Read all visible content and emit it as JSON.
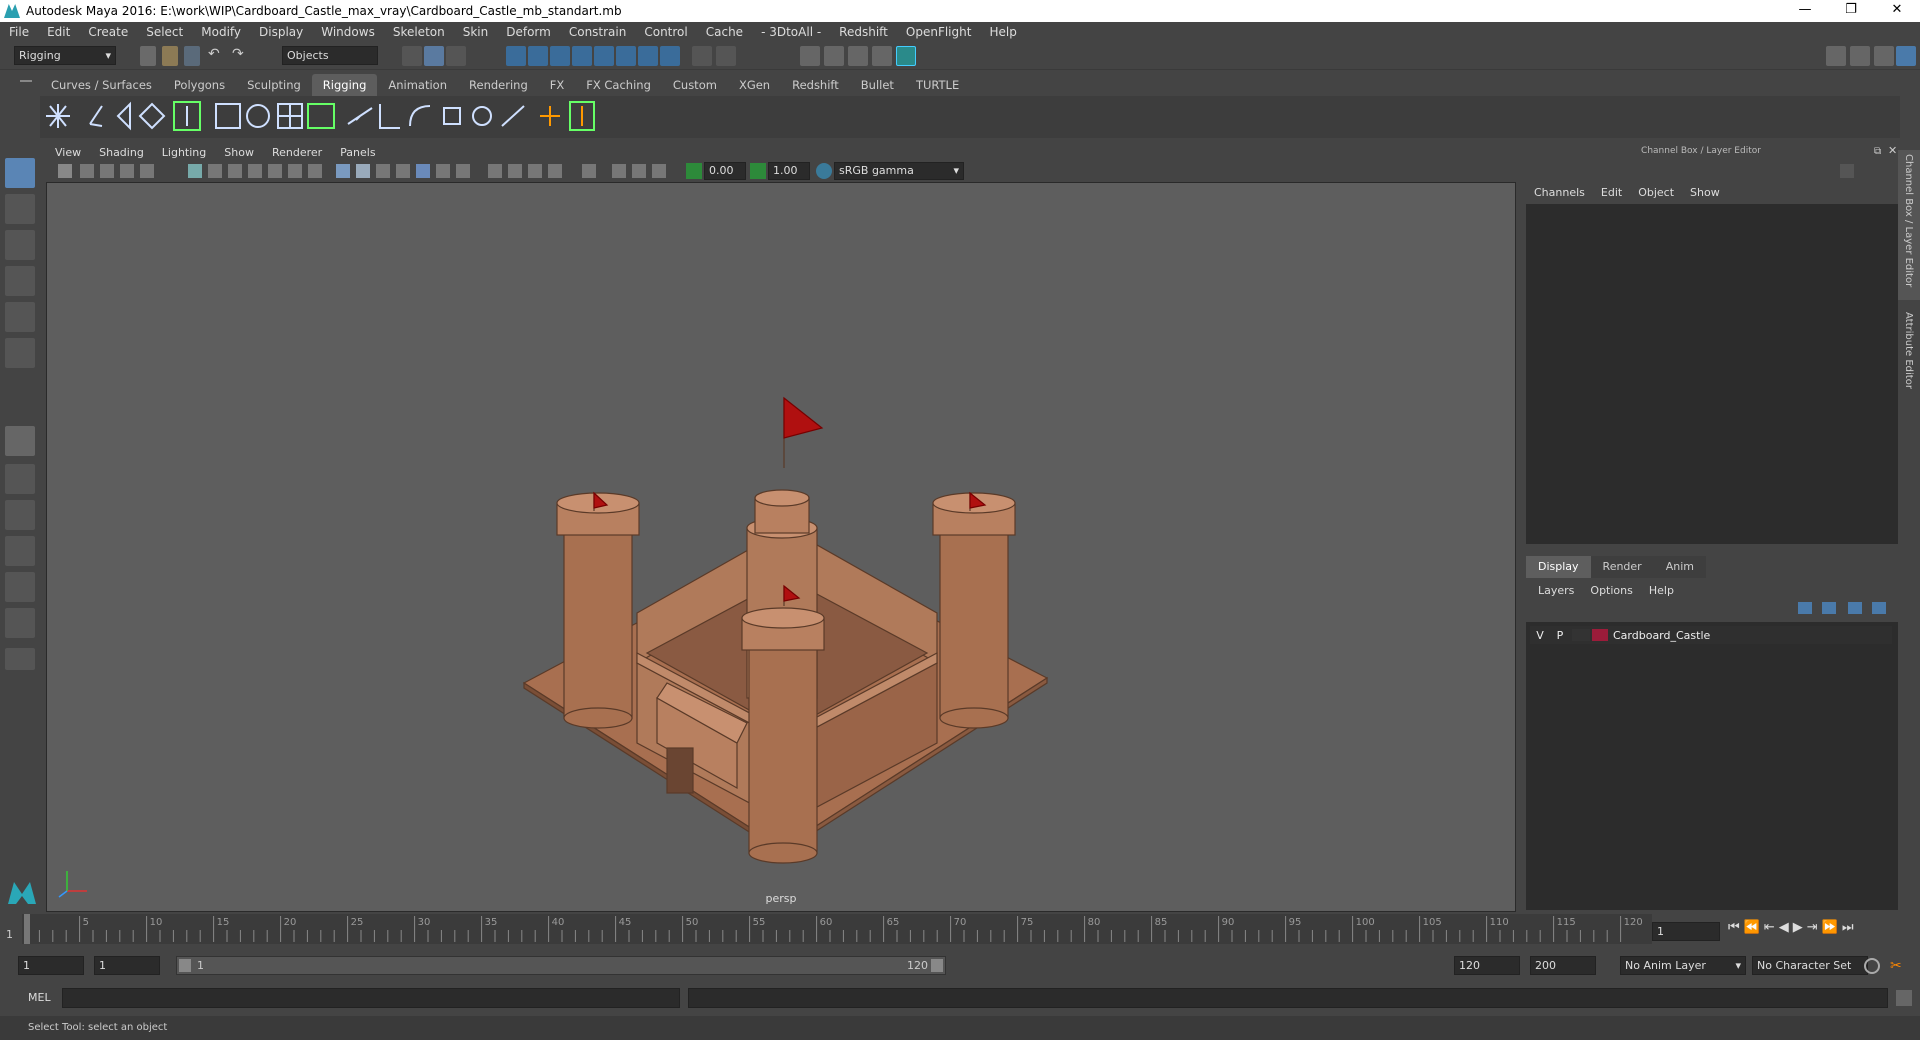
{
  "window": {
    "title": "Autodesk Maya 2016: E:\\work\\WIP\\Cardboard_Castle_max_vray\\Cardboard_Castle_mb_standart.mb",
    "controls": [
      "—",
      "❐",
      "✕"
    ]
  },
  "menubar": [
    "File",
    "Edit",
    "Create",
    "Select",
    "Modify",
    "Display",
    "Windows",
    "Skeleton",
    "Skin",
    "Deform",
    "Constrain",
    "Control",
    "Cache",
    "- 3DtoAll -",
    "Redshift",
    "OpenFlight",
    "Help"
  ],
  "statusline": {
    "menuset": "Rigging",
    "selection_mask": "Objects"
  },
  "shelf": {
    "tabs": [
      "Curves / Surfaces",
      "Polygons",
      "Sculpting",
      "Rigging",
      "Animation",
      "Rendering",
      "FX",
      "FX Caching",
      "Custom",
      "XGen",
      "Redshift",
      "Bullet",
      "TURTLE"
    ],
    "active_tab": "Rigging"
  },
  "viewport": {
    "menu": [
      "View",
      "Shading",
      "Lighting",
      "Show",
      "Renderer",
      "Panels"
    ],
    "exposure": "0.00",
    "gamma": "1.00",
    "color_space": "sRGB gamma",
    "camera_label": "persp",
    "model_color": "#b07a5a"
  },
  "channel_box": {
    "title": "Channel Box / Layer Editor",
    "menu": [
      "Channels",
      "Edit",
      "Object",
      "Show"
    ]
  },
  "layer_editor": {
    "tabs": [
      "Display",
      "Render",
      "Anim"
    ],
    "active_tab": "Display",
    "menu": [
      "Layers",
      "Options",
      "Help"
    ],
    "layers": [
      {
        "v": "V",
        "p": "P",
        "name": "Cardboard_Castle",
        "color": "#9b1c3a"
      }
    ]
  },
  "side_tabs": [
    "Channel Box / Layer Editor",
    "Attribute Editor"
  ],
  "timeline": {
    "ticks": [
      "5",
      "10",
      "15",
      "20",
      "25",
      "30",
      "35",
      "40",
      "45",
      "50",
      "55",
      "60",
      "65",
      "70",
      "75",
      "80",
      "85",
      "90",
      "95",
      "100",
      "105",
      "110",
      "115",
      "120"
    ],
    "start_frame": "1",
    "current_frame": "1"
  },
  "range": {
    "start": "1",
    "inner_start": "1",
    "slider_start": "1",
    "slider_end": "120",
    "inner_end": "120",
    "end": "200",
    "anim_layer": "No Anim Layer",
    "character_set": "No Character Set"
  },
  "command": {
    "label": "MEL"
  },
  "help": {
    "text": "Select Tool: select an object"
  }
}
